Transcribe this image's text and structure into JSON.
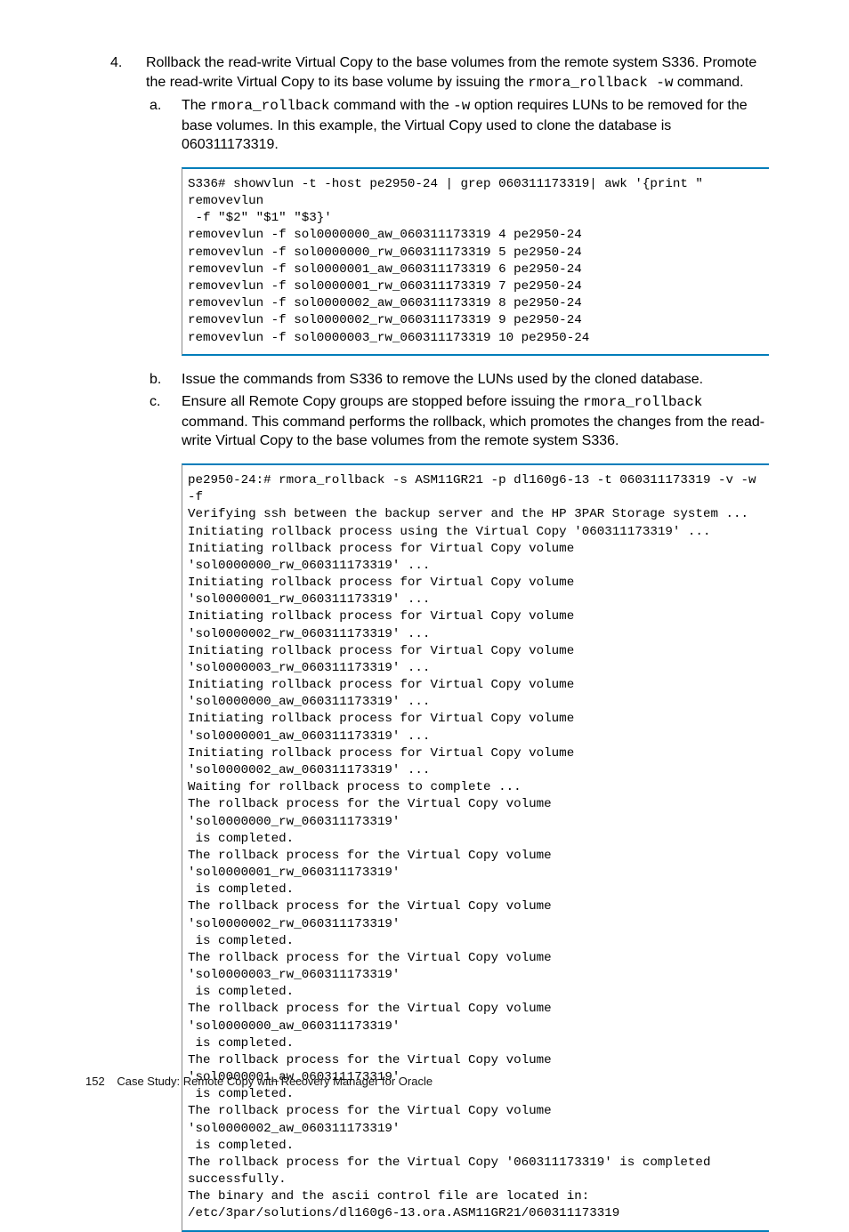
{
  "item4": {
    "num": "4.",
    "text_before_cmd": "Rollback the read-write Virtual Copy to the base volumes from the remote system S336. Promote the read-write Virtual Copy to its base volume by issuing the ",
    "cmd": "rmora_rollback -w",
    "text_after_cmd": " command.",
    "a": {
      "num": "a.",
      "t1": "The ",
      "cmd1": "rmora_rollback",
      "t2": " command with the ",
      "cmd2": "-w",
      "t3": " option requires LUNs to be removed for the base volumes. In this example, the Virtual Copy used to clone the database is 060311173319."
    },
    "b": {
      "num": "b.",
      "text": "Issue the commands from S336 to remove the LUNs used by the cloned database."
    },
    "c": {
      "num": "c.",
      "t1": "Ensure all Remote Copy groups are stopped before issuing the ",
      "cmd": "rmora_rollback",
      "t2": " command. This command performs the rollback, which promotes the changes from the read-write Virtual Copy to the base volumes from the remote system S336."
    }
  },
  "code1": "S336# showvlun -t -host pe2950-24 | grep 060311173319| awk '{print \" removevlun\n -f \"$2\" \"$1\" \"$3}'\nremovevlun -f sol0000000_aw_060311173319 4 pe2950-24\nremovevlun -f sol0000000_rw_060311173319 5 pe2950-24\nremovevlun -f sol0000001_aw_060311173319 6 pe2950-24\nremovevlun -f sol0000001_rw_060311173319 7 pe2950-24\nremovevlun -f sol0000002_aw_060311173319 8 pe2950-24\nremovevlun -f sol0000002_rw_060311173319 9 pe2950-24\nremovevlun -f sol0000003_rw_060311173319 10 pe2950-24",
  "code2": "pe2950-24:# rmora_rollback -s ASM11GR21 -p dl160g6-13 -t 060311173319 -v -w -f\nVerifying ssh between the backup server and the HP 3PAR Storage system ...\nInitiating rollback process using the Virtual Copy '060311173319' ...\nInitiating rollback process for Virtual Copy volume 'sol0000000_rw_060311173319' ...\nInitiating rollback process for Virtual Copy volume 'sol0000001_rw_060311173319' ...\nInitiating rollback process for Virtual Copy volume 'sol0000002_rw_060311173319' ...\nInitiating rollback process for Virtual Copy volume 'sol0000003_rw_060311173319' ...\nInitiating rollback process for Virtual Copy volume 'sol0000000_aw_060311173319' ...\nInitiating rollback process for Virtual Copy volume 'sol0000001_aw_060311173319' ...\nInitiating rollback process for Virtual Copy volume 'sol0000002_aw_060311173319' ...\nWaiting for rollback process to complete ...\nThe rollback process for the Virtual Copy volume 'sol0000000_rw_060311173319'\n is completed.\nThe rollback process for the Virtual Copy volume 'sol0000001_rw_060311173319'\n is completed.\nThe rollback process for the Virtual Copy volume 'sol0000002_rw_060311173319'\n is completed.\nThe rollback process for the Virtual Copy volume 'sol0000003_rw_060311173319'\n is completed.\nThe rollback process for the Virtual Copy volume 'sol0000000_aw_060311173319'\n is completed.\nThe rollback process for the Virtual Copy volume 'sol0000001_aw_060311173319'\n is completed.\nThe rollback process for the Virtual Copy volume 'sol0000002_aw_060311173319'\n is completed.\nThe rollback process for the Virtual Copy '060311173319' is completed successfully.\nThe binary and the ascii control file are located in:\n/etc/3par/solutions/dl160g6-13.ora.ASM11GR21/060311173319",
  "footer": {
    "page": "152",
    "title": "Case Study: Remote Copy with Recovery Manager for Oracle"
  }
}
